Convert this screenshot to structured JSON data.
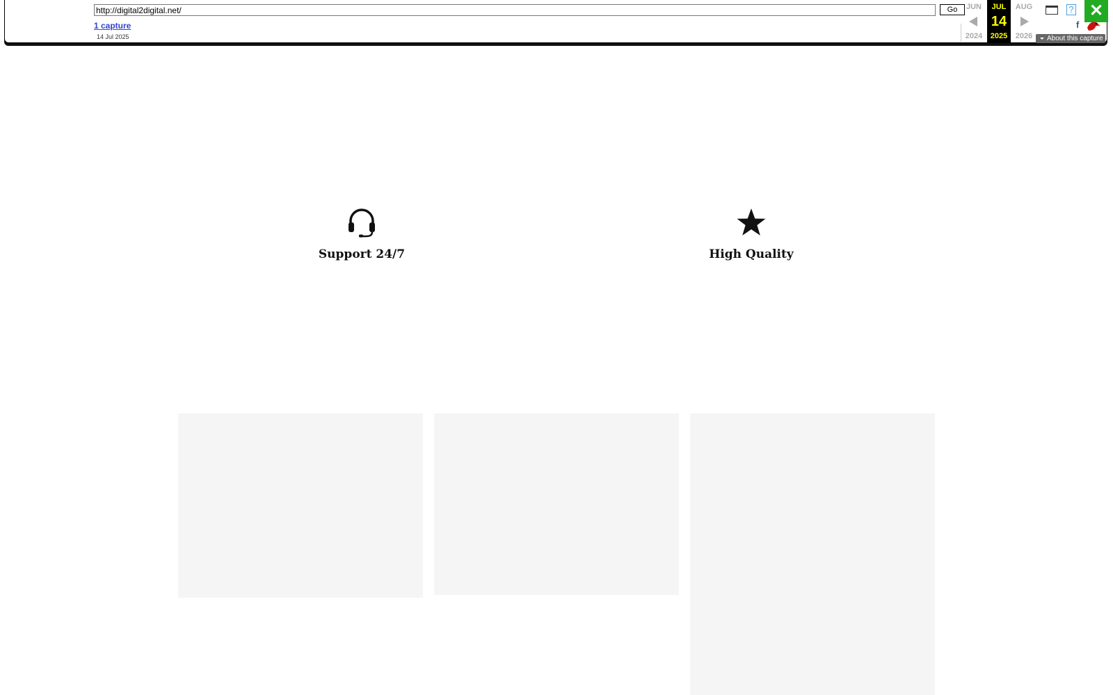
{
  "toolbar": {
    "url_value": "http://digital2digital.net/",
    "go_label": "Go",
    "captures_link": "1 capture",
    "captures_date": "14 Jul 2025",
    "calendar": {
      "prev": {
        "month": "JUN",
        "year": "2024"
      },
      "current": {
        "month": "JUL",
        "day": "14",
        "year": "2025"
      },
      "next": {
        "month": "AUG",
        "year": "2026"
      }
    },
    "help_label": "?",
    "close_label": "✕",
    "facebook_label": "f",
    "about_label": "About this capture"
  },
  "features": [
    {
      "icon": "headset-icon",
      "title": "Support 24/7"
    },
    {
      "icon": "star-icon",
      "title": "High Quality"
    }
  ],
  "colors": {
    "current_date_bg": "#000000",
    "current_date_fg": "#ffff00",
    "close_bg": "#22aa22",
    "card_bg": "#f5f5f5",
    "link": "#3344cc"
  }
}
